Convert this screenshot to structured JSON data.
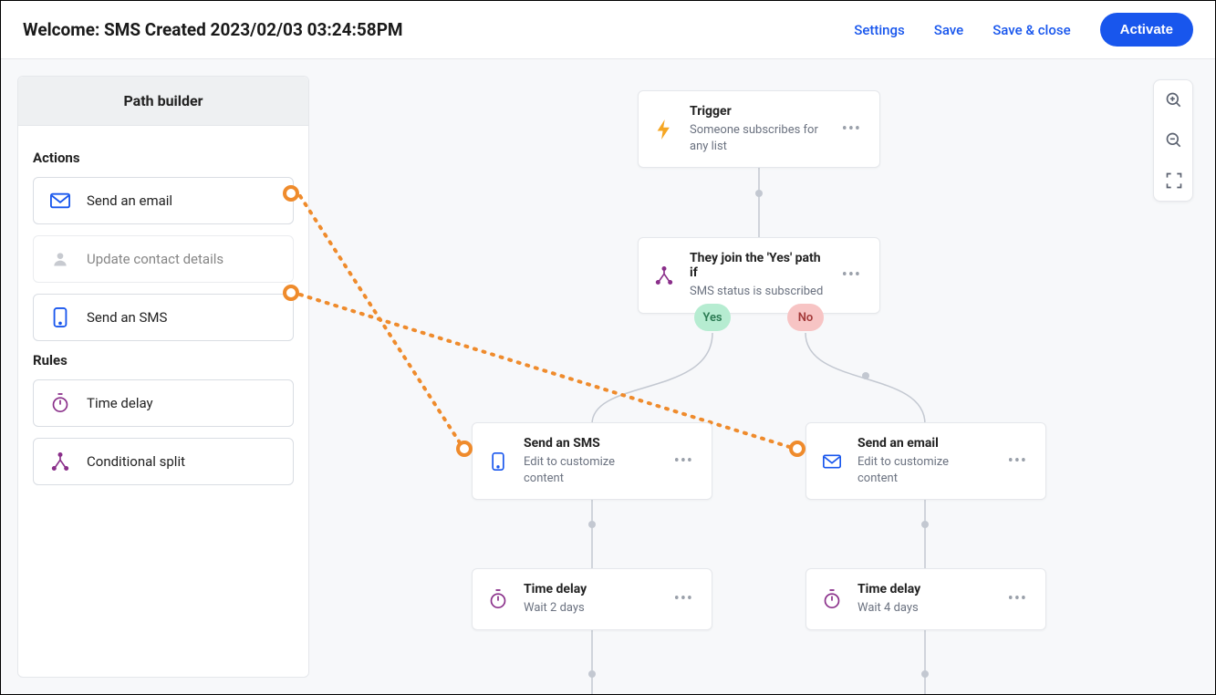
{
  "header": {
    "title": "Welcome: SMS Created 2023/02/03 03:24:58PM",
    "links": {
      "settings": "Settings",
      "save": "Save",
      "saveClose": "Save & close",
      "activate": "Activate"
    }
  },
  "sidebar": {
    "title": "Path builder",
    "sections": {
      "actionsLabel": "Actions",
      "rulesLabel": "Rules"
    },
    "actions": [
      {
        "label": "Send an email"
      },
      {
        "label": "Update contact details"
      },
      {
        "label": "Send an SMS"
      }
    ],
    "rules": [
      {
        "label": "Time delay"
      },
      {
        "label": "Conditional split"
      }
    ]
  },
  "flow": {
    "trigger": {
      "title": "Trigger",
      "sub": "Someone subscribes for any list"
    },
    "condition": {
      "title": "They join the 'Yes' path if",
      "sub": "SMS status is subscribed"
    },
    "badges": {
      "yes": "Yes",
      "no": "No"
    },
    "sms": {
      "title": "Send an SMS",
      "sub": "Edit to customize content"
    },
    "email": {
      "title": "Send an email",
      "sub": "Edit to customize content"
    },
    "delayLeft": {
      "title": "Time delay",
      "sub": "Wait 2 days"
    },
    "delayRight": {
      "title": "Time delay",
      "sub": "Wait 4 days"
    }
  },
  "colors": {
    "accent": "#1856ed",
    "annotation": "#ef8b2c",
    "purple": "#8a2f8a",
    "triggerIcon": "#f5a623",
    "badgeYesBg": "#b6ecd1",
    "badgeNoBg": "#f7c4c4"
  }
}
